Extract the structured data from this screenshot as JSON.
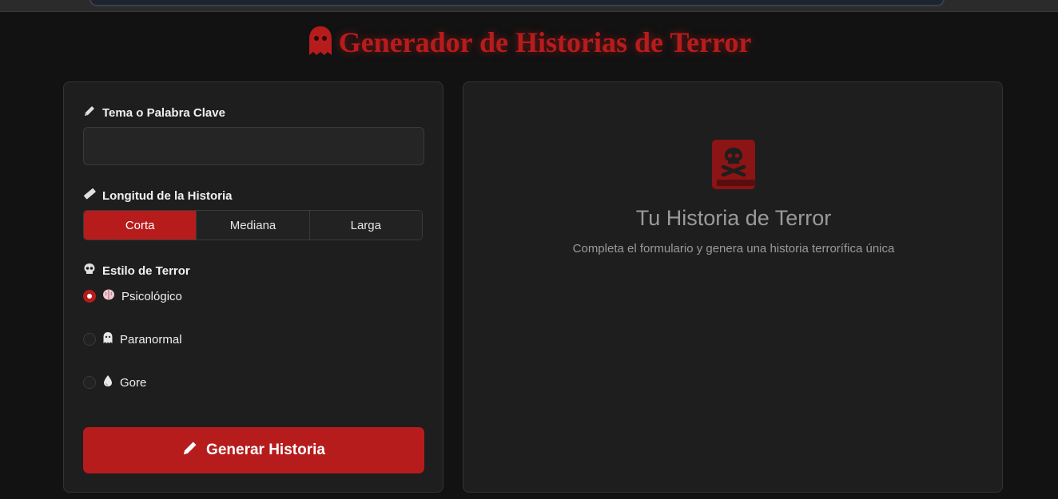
{
  "header": {
    "title": "Generador de Historias de Terror",
    "icon": "ghost-icon"
  },
  "form": {
    "theme": {
      "label": "Tema o Palabra Clave",
      "icon": "pencil-icon",
      "value": "",
      "placeholder": ""
    },
    "length": {
      "label": "Longitud de la Historia",
      "icon": "ruler-icon",
      "options": [
        "Corta",
        "Mediana",
        "Larga"
      ],
      "selected": "Corta"
    },
    "style": {
      "label": "Estilo de Terror",
      "icon": "skull-icon",
      "options": [
        {
          "label": "Psicológico",
          "icon": "brain-icon",
          "checked": true
        },
        {
          "label": "Paranormal",
          "icon": "ghost-icon",
          "checked": false
        },
        {
          "label": "Gore",
          "icon": "drop-icon",
          "checked": false
        }
      ]
    },
    "generate_label": "Generar Historia"
  },
  "result": {
    "icon": "skull-book-icon",
    "title": "Tu Historia de Terror",
    "subtitle": "Completa el formulario y genera una historia terrorífica única"
  },
  "colors": {
    "accent": "#b71c1c",
    "background": "#121212",
    "panel": "#1e1e1e"
  }
}
